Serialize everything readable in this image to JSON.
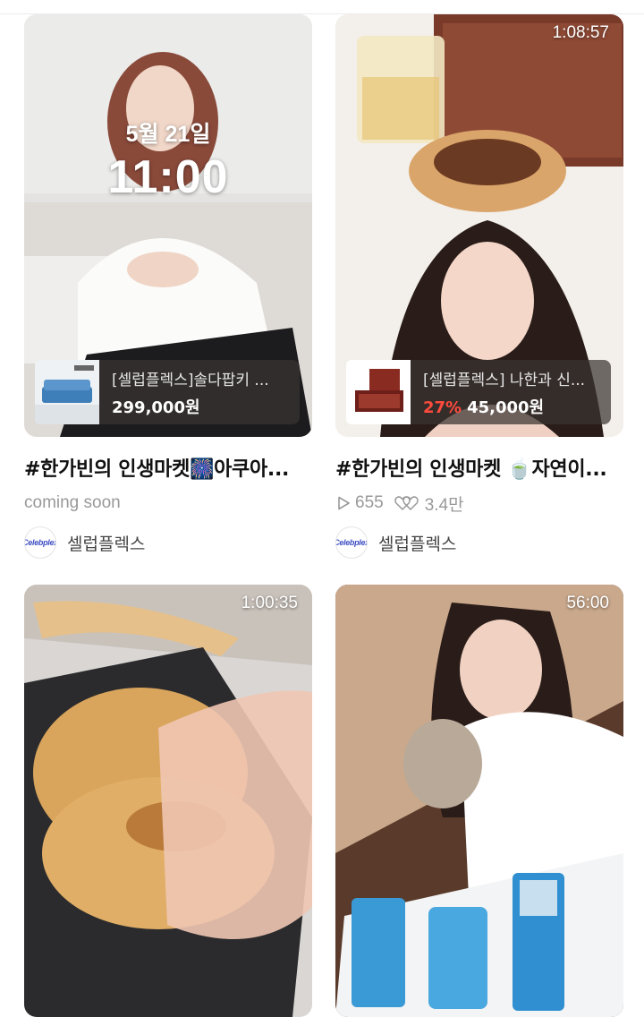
{
  "feed": [
    {
      "schedule_date": "5월 21일",
      "schedule_time": "11:00",
      "product_name": "[셀럽플렉스]솔다팝키 ...",
      "product_price": "299,000원",
      "title": "#한가빈의 인생마켓🎆아쿠아...",
      "status": "coming soon",
      "seller_logo": "Celebplex",
      "seller_name": "셀럽플렉스"
    },
    {
      "duration": "1:08:57",
      "product_name": "[셀럽플렉스] 나한과 신...",
      "product_discount": "27%",
      "product_price": "45,000원",
      "title": "#한가빈의 인생마켓 🍵자연이...",
      "views": "655",
      "likes": "3.4만",
      "seller_logo": "Celebplex",
      "seller_name": "셀럽플렉스"
    },
    {
      "duration": "1:00:35"
    },
    {
      "duration": "56:00"
    }
  ],
  "icons": [
    "play-icon",
    "heart-icon"
  ],
  "colors": {
    "discount": "#ff4b3e",
    "muted": "#999999",
    "logo": "#3f4fc4"
  }
}
